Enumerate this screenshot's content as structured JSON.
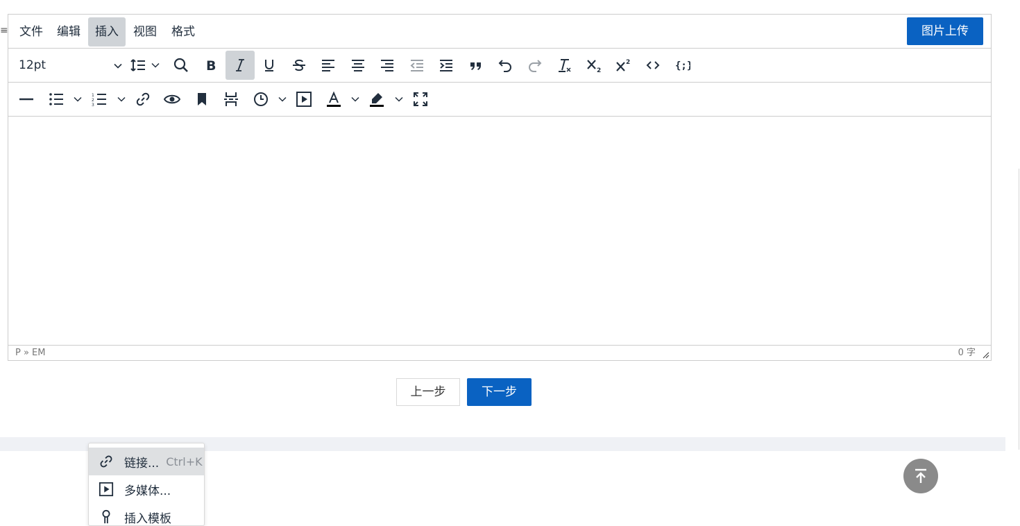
{
  "editor": {
    "menubar": {
      "items": [
        {
          "label": "文件"
        },
        {
          "label": "编辑"
        },
        {
          "label": "插入",
          "active": true
        },
        {
          "label": "视图"
        },
        {
          "label": "格式"
        }
      ],
      "upload_label": "图片上传"
    },
    "toolbar": {
      "font_size": "12pt",
      "buttons_row1": [
        "line-height-icon",
        "search-icon",
        "bold-icon",
        "italic-icon",
        "underline-icon",
        "strikethrough-icon",
        "align-left-icon",
        "align-center-icon",
        "align-right-icon",
        "outdent-icon",
        "indent-icon",
        "blockquote-icon",
        "undo-icon",
        "redo-icon",
        "clear-format-icon",
        "subscript-icon",
        "superscript-icon",
        "code-icon",
        "code-sample-icon"
      ],
      "buttons_row2": [
        "horizontal-rule-icon",
        "bullet-list-icon",
        "numbered-list-icon",
        "link-icon",
        "preview-icon",
        "bookmark-icon",
        "page-break-icon",
        "datetime-icon",
        "media-icon",
        "text-color-icon",
        "highlight-icon",
        "fullscreen-icon"
      ]
    },
    "statusbar": {
      "path": "P » EM",
      "wordcount": "0 字"
    }
  },
  "buttons": {
    "prev": "上一步",
    "next": "下一步"
  },
  "insert_menu": {
    "items": [
      {
        "label": "链接...",
        "shortcut": "Ctrl+K",
        "icon": "link-icon"
      },
      {
        "label": "多媒体...",
        "icon": "media-icon"
      },
      {
        "label": "插入模板",
        "icon": "template-icon"
      }
    ]
  },
  "colors": {
    "accent": "#0a62c2",
    "active_bg": "#cfd3d7",
    "border": "#cccccc"
  }
}
